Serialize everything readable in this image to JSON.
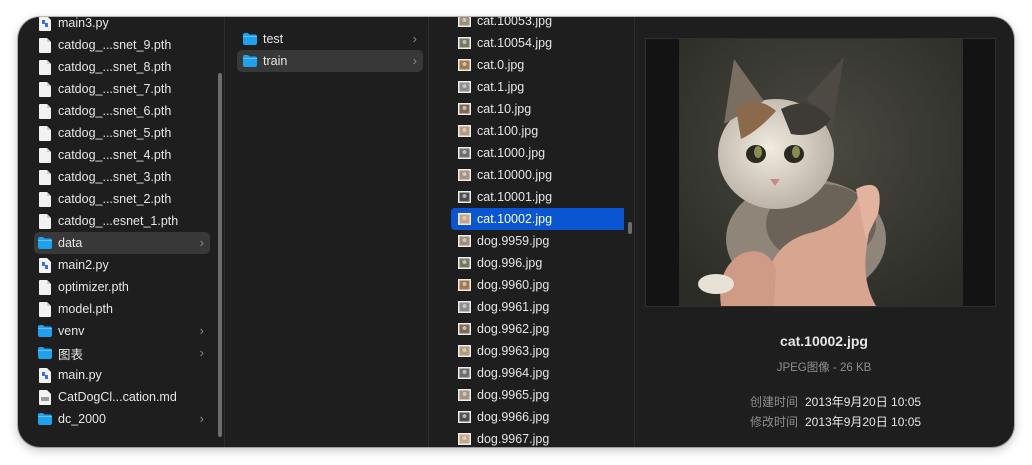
{
  "column1": {
    "items": [
      {
        "label": "main3.py",
        "icon": "python-file-icon",
        "chevron": false,
        "highlight": false
      },
      {
        "label": "catdog_...snet_9.pth",
        "icon": "document-icon",
        "chevron": false,
        "highlight": false
      },
      {
        "label": "catdog_...snet_8.pth",
        "icon": "document-icon",
        "chevron": false,
        "highlight": false
      },
      {
        "label": "catdog_...snet_7.pth",
        "icon": "document-icon",
        "chevron": false,
        "highlight": false
      },
      {
        "label": "catdog_...snet_6.pth",
        "icon": "document-icon",
        "chevron": false,
        "highlight": false
      },
      {
        "label": "catdog_...snet_5.pth",
        "icon": "document-icon",
        "chevron": false,
        "highlight": false
      },
      {
        "label": "catdog_...snet_4.pth",
        "icon": "document-icon",
        "chevron": false,
        "highlight": false
      },
      {
        "label": "catdog_...snet_3.pth",
        "icon": "document-icon",
        "chevron": false,
        "highlight": false
      },
      {
        "label": "catdog_...snet_2.pth",
        "icon": "document-icon",
        "chevron": false,
        "highlight": false
      },
      {
        "label": "catdog_...esnet_1.pth",
        "icon": "document-icon",
        "chevron": false,
        "highlight": false
      },
      {
        "label": "data",
        "icon": "folder-icon",
        "chevron": true,
        "highlight": true
      },
      {
        "label": "main2.py",
        "icon": "python-file-icon",
        "chevron": false,
        "highlight": false
      },
      {
        "label": "optimizer.pth",
        "icon": "document-icon",
        "chevron": false,
        "highlight": false
      },
      {
        "label": "model.pth",
        "icon": "document-icon",
        "chevron": false,
        "highlight": false
      },
      {
        "label": "venv",
        "icon": "folder-icon",
        "chevron": true,
        "highlight": false
      },
      {
        "label": "图表",
        "icon": "folder-icon",
        "chevron": true,
        "highlight": false
      },
      {
        "label": "main.py",
        "icon": "python-file-icon",
        "chevron": false,
        "highlight": false
      },
      {
        "label": "CatDogCl...cation.md",
        "icon": "markdown-file-icon",
        "chevron": false,
        "highlight": false
      },
      {
        "label": "dc_2000",
        "icon": "folder-icon",
        "chevron": true,
        "highlight": false
      }
    ]
  },
  "column2": {
    "items": [
      {
        "label": "test",
        "icon": "folder-icon",
        "chevron": true,
        "highlight": false
      },
      {
        "label": "train",
        "icon": "folder-icon",
        "chevron": true,
        "highlight": true
      }
    ]
  },
  "column3": {
    "items": [
      {
        "label": "cat.10053.jpg",
        "icon": "image-thumbnail-icon",
        "selected": false
      },
      {
        "label": "cat.10054.jpg",
        "icon": "image-thumbnail-icon",
        "selected": false
      },
      {
        "label": "cat.0.jpg",
        "icon": "image-thumbnail-icon",
        "selected": false
      },
      {
        "label": "cat.1.jpg",
        "icon": "image-thumbnail-icon",
        "selected": false
      },
      {
        "label": "cat.10.jpg",
        "icon": "image-thumbnail-icon",
        "selected": false
      },
      {
        "label": "cat.100.jpg",
        "icon": "image-thumbnail-icon",
        "selected": false
      },
      {
        "label": "cat.1000.jpg",
        "icon": "image-thumbnail-icon",
        "selected": false
      },
      {
        "label": "cat.10000.jpg",
        "icon": "image-thumbnail-icon",
        "selected": false
      },
      {
        "label": "cat.10001.jpg",
        "icon": "image-thumbnail-icon",
        "selected": false
      },
      {
        "label": "cat.10002.jpg",
        "icon": "image-thumbnail-icon",
        "selected": true
      },
      {
        "label": "dog.9959.jpg",
        "icon": "image-thumbnail-icon",
        "selected": false
      },
      {
        "label": "dog.996.jpg",
        "icon": "image-thumbnail-icon",
        "selected": false
      },
      {
        "label": "dog.9960.jpg",
        "icon": "image-thumbnail-icon",
        "selected": false
      },
      {
        "label": "dog.9961.jpg",
        "icon": "image-thumbnail-icon",
        "selected": false
      },
      {
        "label": "dog.9962.jpg",
        "icon": "image-thumbnail-icon",
        "selected": false
      },
      {
        "label": "dog.9963.jpg",
        "icon": "image-thumbnail-icon",
        "selected": false
      },
      {
        "label": "dog.9964.jpg",
        "icon": "image-thumbnail-icon",
        "selected": false
      },
      {
        "label": "dog.9965.jpg",
        "icon": "image-thumbnail-icon",
        "selected": false
      },
      {
        "label": "dog.9966.jpg",
        "icon": "image-thumbnail-icon",
        "selected": false
      },
      {
        "label": "dog.9967.jpg",
        "icon": "image-thumbnail-icon",
        "selected": false
      }
    ]
  },
  "preview": {
    "file_name": "cat.10002.jpg",
    "kind_size": "JPEG图像 - 26 KB",
    "info": [
      {
        "key": "创建时间",
        "value": "2013年9月20日 10:05"
      },
      {
        "key": "修改时间",
        "value": "2013年9月20日 10:05"
      }
    ]
  },
  "colors": {
    "window_bg": "#1e1e1e",
    "selection_blue": "#0a55d2",
    "row_highlight": "#383838",
    "folder_blue": "#1fa2ee",
    "text_primary": "#e6e6e6",
    "text_secondary": "#8e8e8e"
  }
}
